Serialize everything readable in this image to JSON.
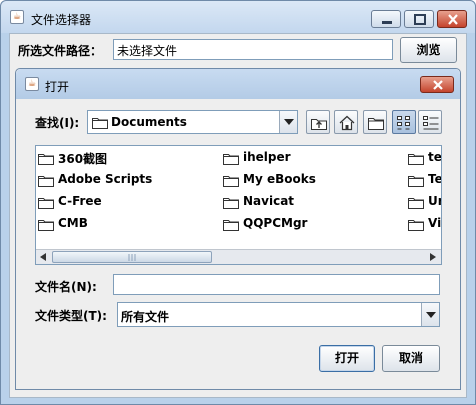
{
  "outer_window": {
    "title": "文件选择器",
    "path_label": "所选文件路径：",
    "path_value": "未选择文件",
    "browse_label": "浏览"
  },
  "dialog": {
    "title": "打开",
    "lookin_label": "查找(I):",
    "lookin_value": "Documents",
    "files": [
      {
        "name": "360截图"
      },
      {
        "name": "Adobe Scripts"
      },
      {
        "name": "C-Free"
      },
      {
        "name": "CMB"
      },
      {
        "name": "ihelper"
      },
      {
        "name": "My eBooks"
      },
      {
        "name": "Navicat"
      },
      {
        "name": "QQPCMgr"
      },
      {
        "name": "te"
      },
      {
        "name": "Te"
      },
      {
        "name": "Ur"
      },
      {
        "name": "Vi"
      }
    ],
    "filename_label": "文件名(N):",
    "filename_value": "",
    "filetype_label": "文件类型(T):",
    "filetype_value": "所有文件",
    "open_label": "打开",
    "cancel_label": "取消"
  },
  "icons": {
    "window": "java-cup-icon",
    "folder": "folder-icon",
    "up_one_level": "up-folder-icon",
    "home": "home-icon",
    "new_folder": "new-folder-icon",
    "list_view": "list-view-icon",
    "details_view": "details-view-icon"
  },
  "colors": {
    "titlebar": "#c3d7ee",
    "panel": "#eeeeee",
    "close_button": "#c4442d",
    "field_border": "#7f9db9"
  }
}
